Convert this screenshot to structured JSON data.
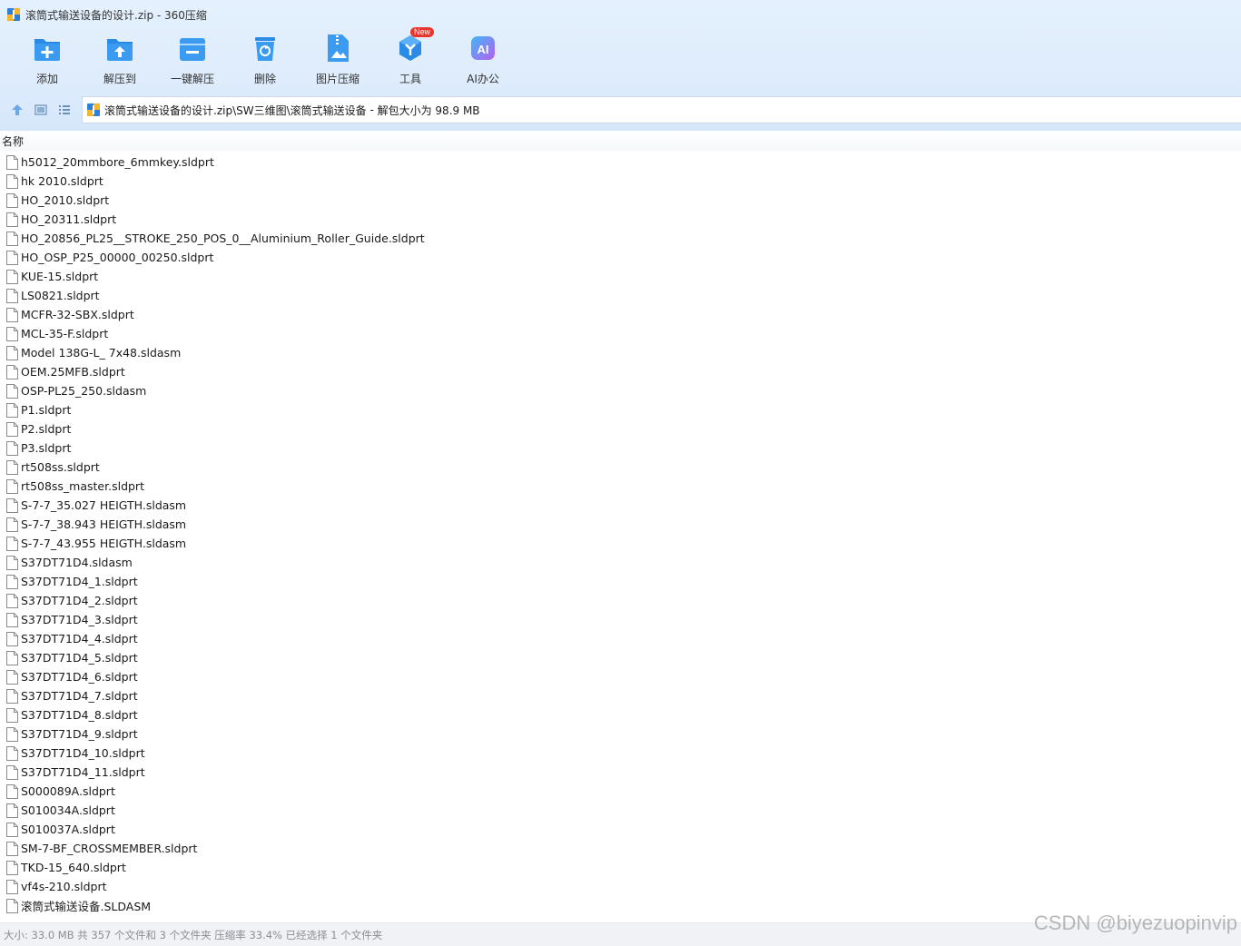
{
  "window": {
    "title": "滚筒式输送设备的设计.zip - 360压缩"
  },
  "toolbar": {
    "items": [
      {
        "label": "添加",
        "icon": "add-icon"
      },
      {
        "label": "解压到",
        "icon": "extract-to-icon"
      },
      {
        "label": "一键解压",
        "icon": "one-click-extract-icon"
      },
      {
        "label": "删除",
        "icon": "delete-icon"
      },
      {
        "label": "图片压缩",
        "icon": "image-compress-icon"
      },
      {
        "label": "工具",
        "icon": "tools-icon",
        "badge": "New"
      },
      {
        "label": "AI办公",
        "icon": "ai-office-icon",
        "icon_text": "AI"
      }
    ]
  },
  "address": {
    "path": "滚筒式输送设备的设计.zip\\SW三维图\\滚筒式输送设备",
    "separator": " - ",
    "info": "解包大小为 98.9 MB"
  },
  "list": {
    "column_header": "名称",
    "files": [
      "h5012_20mmbore_6mmkey.sldprt",
      "hk 2010.sldprt",
      "HO_2010.sldprt",
      "HO_20311.sldprt",
      "HO_20856_PL25__STROKE_250_POS_0__Aluminium_Roller_Guide.sldprt",
      "HO_OSP_P25_00000_00250.sldprt",
      "KUE-15.sldprt",
      "LS0821.sldprt",
      "MCFR-32-SBX.sldprt",
      "MCL-35-F.sldprt",
      "Model 138G-L_ 7x48.sldasm",
      "OEM.25MFB.sldprt",
      "OSP-PL25_250.sldasm",
      "P1.sldprt",
      "P2.sldprt",
      "P3.sldprt",
      "rt508ss.sldprt",
      "rt508ss_master.sldprt",
      "S-7-7_35.027 HEIGTH.sldasm",
      "S-7-7_38.943 HEIGTH.sldasm",
      "S-7-7_43.955 HEIGTH.sldasm",
      "S37DT71D4.sldasm",
      "S37DT71D4_1.sldprt",
      "S37DT71D4_2.sldprt",
      "S37DT71D4_3.sldprt",
      "S37DT71D4_4.sldprt",
      "S37DT71D4_5.sldprt",
      "S37DT71D4_6.sldprt",
      "S37DT71D4_7.sldprt",
      "S37DT71D4_8.sldprt",
      "S37DT71D4_9.sldprt",
      "S37DT71D4_10.sldprt",
      "S37DT71D4_11.sldprt",
      "S000089A.sldprt",
      "S010034A.sldprt",
      "S010037A.sldprt",
      "SM-7-BF_CROSSMEMBER.sldprt",
      "TKD-15_640.sldprt",
      "vf4s-210.sldprt",
      "滚筒式输送设备.SLDASM"
    ]
  },
  "status": {
    "text": "大小: 33.0 MB 共 357 个文件和 3 个文件夹 压缩率 33.4% 已经选择 1 个文件夹"
  },
  "watermark": "CSDN @biyezuopinvip",
  "colors": {
    "accent": "#2a8ae6",
    "toolbar_bg": "#deecfc",
    "badge": "#e8362d",
    "ai_gradient_start": "#3fb6f5",
    "ai_gradient_end": "#b760f0"
  }
}
